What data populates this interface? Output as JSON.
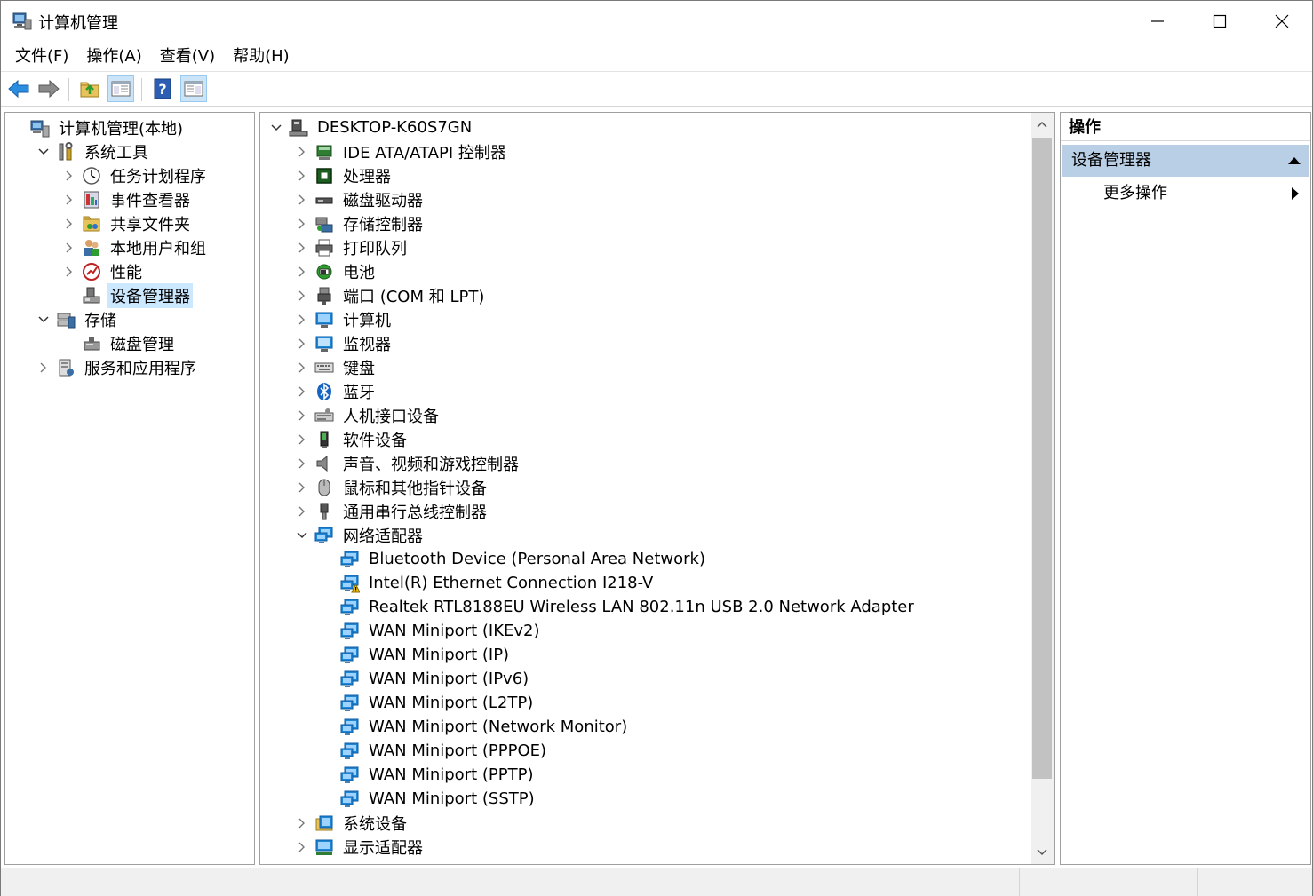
{
  "window": {
    "title": "计算机管理",
    "minimize_icon": "minimize-icon",
    "maximize_icon": "maximize-icon",
    "close_icon": "close-icon"
  },
  "menu": [
    "文件(F)",
    "操作(A)",
    "查看(V)",
    "帮助(H)"
  ],
  "toolbar": {
    "icons": [
      "back-arrow-icon",
      "forward-arrow-icon",
      "up-folder-icon",
      "show-hide-console-tree-icon",
      "help-icon",
      "show-hide-action-pane-icon"
    ]
  },
  "left_tree": [
    {
      "label": "计算机管理(本地)",
      "level": 0,
      "expander": "none",
      "icon": "computer-management-icon"
    },
    {
      "label": "系统工具",
      "level": 1,
      "expander": "open",
      "icon": "tools-icon"
    },
    {
      "label": "任务计划程序",
      "level": 2,
      "expander": "closed",
      "icon": "clock-icon"
    },
    {
      "label": "事件查看器",
      "level": 2,
      "expander": "closed",
      "icon": "event-viewer-icon"
    },
    {
      "label": "共享文件夹",
      "level": 2,
      "expander": "closed",
      "icon": "shared-folder-icon"
    },
    {
      "label": "本地用户和组",
      "level": 2,
      "expander": "closed",
      "icon": "users-icon"
    },
    {
      "label": "性能",
      "level": 2,
      "expander": "closed",
      "icon": "performance-icon"
    },
    {
      "label": "设备管理器",
      "level": 2,
      "expander": "none",
      "icon": "device-manager-icon",
      "selected": true
    },
    {
      "label": "存储",
      "level": 1,
      "expander": "open",
      "icon": "storage-icon"
    },
    {
      "label": "磁盘管理",
      "level": 2,
      "expander": "none",
      "icon": "disk-management-icon"
    },
    {
      "label": "服务和应用程序",
      "level": 1,
      "expander": "closed",
      "icon": "services-icon"
    }
  ],
  "device_tree": [
    {
      "label": "DESKTOP-K60S7GN",
      "level": 0,
      "expander": "open",
      "icon": "computer-root-icon"
    },
    {
      "label": "IDE ATA/ATAPI 控制器",
      "level": 1,
      "expander": "closed",
      "icon": "ide-controller-icon"
    },
    {
      "label": "处理器",
      "level": 1,
      "expander": "closed",
      "icon": "processor-icon"
    },
    {
      "label": "磁盘驱动器",
      "level": 1,
      "expander": "closed",
      "icon": "disk-drive-icon"
    },
    {
      "label": "存储控制器",
      "level": 1,
      "expander": "closed",
      "icon": "storage-controller-icon"
    },
    {
      "label": "打印队列",
      "level": 1,
      "expander": "closed",
      "icon": "printer-icon"
    },
    {
      "label": "电池",
      "level": 1,
      "expander": "closed",
      "icon": "battery-icon"
    },
    {
      "label": "端口 (COM 和 LPT)",
      "level": 1,
      "expander": "closed",
      "icon": "port-icon"
    },
    {
      "label": "计算机",
      "level": 1,
      "expander": "closed",
      "icon": "computer-icon"
    },
    {
      "label": "监视器",
      "level": 1,
      "expander": "closed",
      "icon": "monitor-icon"
    },
    {
      "label": "键盘",
      "level": 1,
      "expander": "closed",
      "icon": "keyboard-icon"
    },
    {
      "label": "蓝牙",
      "level": 1,
      "expander": "closed",
      "icon": "bluetooth-icon"
    },
    {
      "label": "人机接口设备",
      "level": 1,
      "expander": "closed",
      "icon": "hid-icon"
    },
    {
      "label": "软件设备",
      "level": 1,
      "expander": "closed",
      "icon": "software-device-icon"
    },
    {
      "label": "声音、视频和游戏控制器",
      "level": 1,
      "expander": "closed",
      "icon": "speaker-icon"
    },
    {
      "label": "鼠标和其他指针设备",
      "level": 1,
      "expander": "closed",
      "icon": "mouse-icon"
    },
    {
      "label": "通用串行总线控制器",
      "level": 1,
      "expander": "closed",
      "icon": "usb-icon"
    },
    {
      "label": "网络适配器",
      "level": 1,
      "expander": "open",
      "icon": "network-adapter-icon"
    },
    {
      "label": "Bluetooth Device (Personal Area Network)",
      "level": 2,
      "expander": "none",
      "icon": "network-adapter-icon"
    },
    {
      "label": "Intel(R) Ethernet Connection I218-V",
      "level": 2,
      "expander": "none",
      "icon": "network-adapter-warning-icon"
    },
    {
      "label": "Realtek RTL8188EU Wireless LAN 802.11n USB 2.0 Network Adapter",
      "level": 2,
      "expander": "none",
      "icon": "network-adapter-icon"
    },
    {
      "label": "WAN Miniport (IKEv2)",
      "level": 2,
      "expander": "none",
      "icon": "network-adapter-icon"
    },
    {
      "label": "WAN Miniport (IP)",
      "level": 2,
      "expander": "none",
      "icon": "network-adapter-icon"
    },
    {
      "label": "WAN Miniport (IPv6)",
      "level": 2,
      "expander": "none",
      "icon": "network-adapter-icon"
    },
    {
      "label": "WAN Miniport (L2TP)",
      "level": 2,
      "expander": "none",
      "icon": "network-adapter-icon"
    },
    {
      "label": "WAN Miniport (Network Monitor)",
      "level": 2,
      "expander": "none",
      "icon": "network-adapter-icon"
    },
    {
      "label": "WAN Miniport (PPPOE)",
      "level": 2,
      "expander": "none",
      "icon": "network-adapter-icon"
    },
    {
      "label": "WAN Miniport (PPTP)",
      "level": 2,
      "expander": "none",
      "icon": "network-adapter-icon"
    },
    {
      "label": "WAN Miniport (SSTP)",
      "level": 2,
      "expander": "none",
      "icon": "network-adapter-icon"
    },
    {
      "label": "系统设备",
      "level": 1,
      "expander": "closed",
      "icon": "system-device-icon"
    },
    {
      "label": "显示适配器",
      "level": 1,
      "expander": "closed",
      "icon": "display-adapter-icon"
    }
  ],
  "actions": {
    "header": "操作",
    "section": "设备管理器",
    "item": "更多操作"
  },
  "colors": {
    "selection": "#cce8ff",
    "action_section": "#b8cfe5",
    "net_blue": "#1e88d8",
    "warning": "#f2c200"
  }
}
